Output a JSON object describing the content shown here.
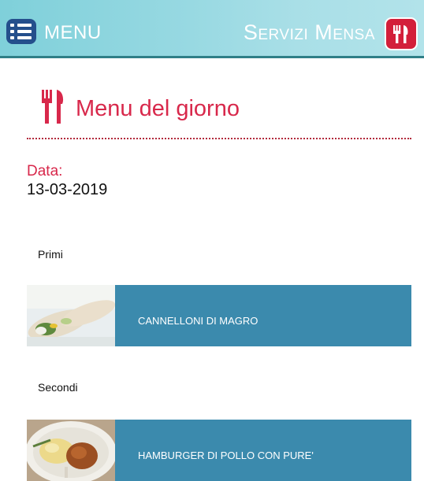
{
  "header": {
    "menu_label": "MENU",
    "app_title": "Servizi Mensa",
    "icons": {
      "menu": "list-menu-icon",
      "app": "fork-knife-icon"
    },
    "colors": {
      "bar_start": "#7fd0da",
      "bar_end": "#b2e3ea",
      "menu_button": "#244f8c",
      "app_button": "#d31f3a"
    }
  },
  "main": {
    "title": "Menu del giorno",
    "title_icon": "fork-knife-icon",
    "date_label": "Data:",
    "date_value": "13-03-2019",
    "accent_color": "#d8284b",
    "sections": [
      {
        "category": "Primi",
        "dish": "CANNELLONI DI MAGRO",
        "image": "cannelloni-photo"
      },
      {
        "category": "Secondi",
        "dish": "HAMBURGER DI POLLO CON PURE'",
        "image": "hamburger-photo"
      }
    ],
    "dish_bar_color": "#3b8aad"
  }
}
